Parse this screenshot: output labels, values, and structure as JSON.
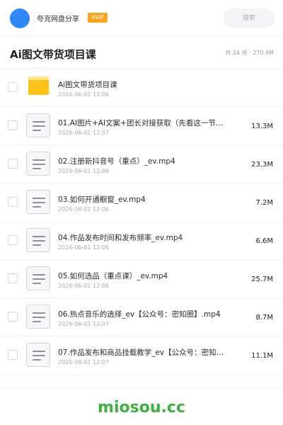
{
  "header": {
    "username": "夸克网盘分享",
    "badge": "SVIP",
    "search_label": "搜索"
  },
  "folder": {
    "title": "Ai图文带货项目课",
    "summary": "共 24 项 · 270.9M"
  },
  "items": [
    {
      "type": "folder",
      "icon": "folder-icon",
      "name": "Ai图文带货项目课",
      "date": "2026-06-01 12:06",
      "size": ""
    },
    {
      "type": "file",
      "icon": "document-icon",
      "name": "01.AI图片+AI文案+团长对接获取（先看这一节…",
      "date": "2026-06-01 12:07",
      "size": "13.3M"
    },
    {
      "type": "file",
      "icon": "document-icon",
      "name": "02.注册新抖音号（重点）_ev.mp4",
      "date": "2026-06-01 12:06",
      "size": "23.3M"
    },
    {
      "type": "file",
      "icon": "document-icon",
      "name": "03.如何开通橱窗_ev.mp4",
      "date": "2026-06-01 12:06",
      "size": "7.2M"
    },
    {
      "type": "file",
      "icon": "document-icon",
      "name": "04.作品发布时间和发布频率_ev.mp4",
      "date": "2026-06-01 12:06",
      "size": "6.6M"
    },
    {
      "type": "file",
      "icon": "document-icon",
      "name": "05.如何选品（重点课）_ev.mp4",
      "date": "2026-06-01 12:06",
      "size": "25.7M"
    },
    {
      "type": "file",
      "icon": "document-icon",
      "name": "06.热点音乐的选择_ev【公众号：密知圈】.mp4",
      "date": "2026-06-01 12:07",
      "size": "8.7M"
    },
    {
      "type": "file",
      "icon": "document-icon",
      "name": "07.作品发布和商品挂载教学_ev【公众号：密知圈…",
      "date": "2026-06-01 12:07",
      "size": "11.1M"
    }
  ],
  "watermark": "miosou.cc",
  "colors": {
    "accent": "#2f86f6",
    "badge": "#f5a623",
    "folder": "#ffc21a",
    "watermark": "#3cb043"
  }
}
